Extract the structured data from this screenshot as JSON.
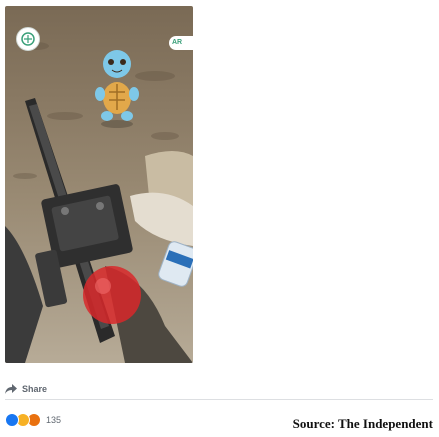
{
  "photo": {
    "ar_label": "AR",
    "description_icon": "pokestop-icon"
  },
  "actions": {
    "share_label": "Share",
    "share_icon": "share-arrow-icon"
  },
  "reactions": {
    "icons": [
      "like-icon",
      "haha-icon",
      "angry-icon"
    ],
    "count": "135"
  },
  "caption": {
    "source": "Source: The Independent"
  },
  "colors": {
    "like": "#1877f2",
    "pokeball_red": "#d8282a",
    "squirtle_blue": "#7ec8e8"
  }
}
